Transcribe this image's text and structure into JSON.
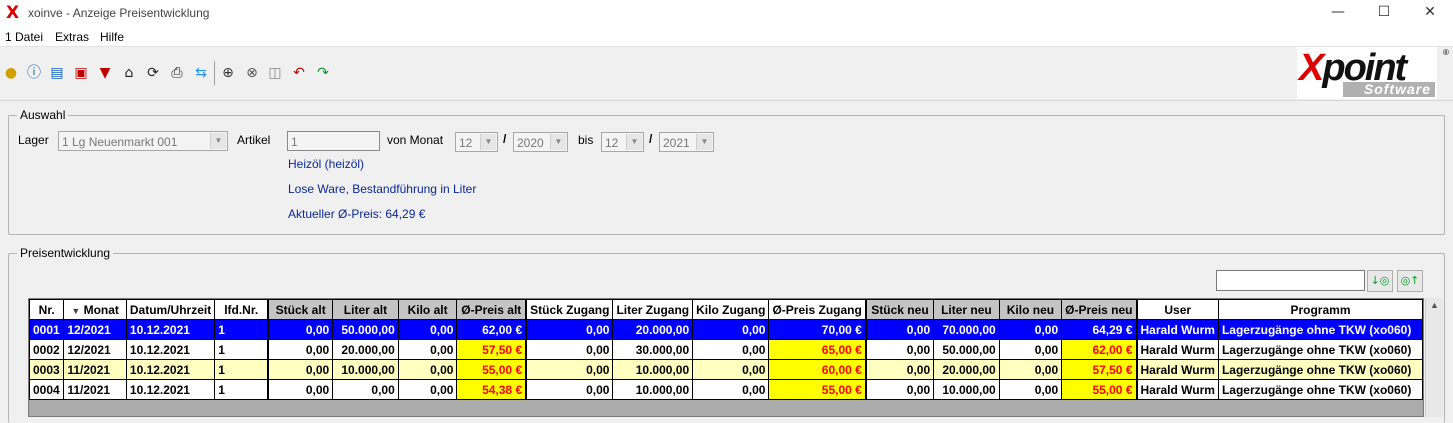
{
  "window": {
    "title": "xoinve - Anzeige Preisentwicklung",
    "app_icon": "X"
  },
  "menu": [
    "1 Datei",
    "Extras",
    "Hilfe"
  ],
  "logo": {
    "main": "point",
    "x": "X",
    "sub": "Software",
    "reg": "®"
  },
  "auswahl": {
    "legend": "Auswahl",
    "lager_label": "Lager",
    "lager_value": "1  Lg Neuenmarkt  001",
    "artikel_label": "Artikel",
    "artikel_value": "1",
    "von_label": "von Monat",
    "von_month": "12",
    "von_year": "2020",
    "bis_label": "bis",
    "bis_month": "12",
    "bis_year": "2021",
    "slash": "/",
    "article_name": "Heizöl (heizöl)",
    "article_desc": "Lose Ware, Bestandführung in Liter",
    "current_price": "Aktueller Ø-Preis: 64,29 €"
  },
  "preis": {
    "legend": "Preisentwicklung",
    "search_value": "",
    "columns": [
      "Nr.",
      "Monat",
      "Datum/Uhrzeit",
      "lfd.Nr.",
      "Stück alt",
      "Liter alt",
      "Kilo alt",
      "Ø-Preis alt",
      "Stück Zugang",
      "Liter Zugang",
      "Kilo Zugang",
      "Ø-Preis Zugang",
      "Stück neu",
      "Liter neu",
      "Kilo neu",
      "Ø-Preis neu",
      "User",
      "Programm"
    ],
    "rows": [
      [
        "0001",
        "12/2021",
        "10.12.2021",
        "1",
        "0,00",
        "50.000,00",
        "0,00",
        "62,00 €",
        "0,00",
        "20.000,00",
        "0,00",
        "70,00 €",
        "0,00",
        "70.000,00",
        "0,00",
        "64,29 €",
        "Harald Wurm",
        "Lagerzugänge ohne TKW (xo060)"
      ],
      [
        "0002",
        "12/2021",
        "10.12.2021",
        "1",
        "0,00",
        "20.000,00",
        "0,00",
        "57,50 €",
        "0,00",
        "30.000,00",
        "0,00",
        "65,00 €",
        "0,00",
        "50.000,00",
        "0,00",
        "62,00 €",
        "Harald Wurm",
        "Lagerzugänge ohne TKW (xo060)"
      ],
      [
        "0003",
        "11/2021",
        "10.12.2021",
        "1",
        "0,00",
        "10.000,00",
        "0,00",
        "55,00 €",
        "0,00",
        "10.000,00",
        "0,00",
        "60,00 €",
        "0,00",
        "20.000,00",
        "0,00",
        "57,50 €",
        "Harald Wurm",
        "Lagerzugänge ohne TKW (xo060)"
      ],
      [
        "0004",
        "11/2021",
        "10.12.2021",
        "1",
        "0,00",
        "0,00",
        "0,00",
        "54,38 €",
        "0,00",
        "10.000,00",
        "0,00",
        "55,00 €",
        "0,00",
        "10.000,00",
        "0,00",
        "55,00 €",
        "Harald Wurm",
        "Lagerzugänge ohne TKW (xo060)"
      ]
    ]
  }
}
